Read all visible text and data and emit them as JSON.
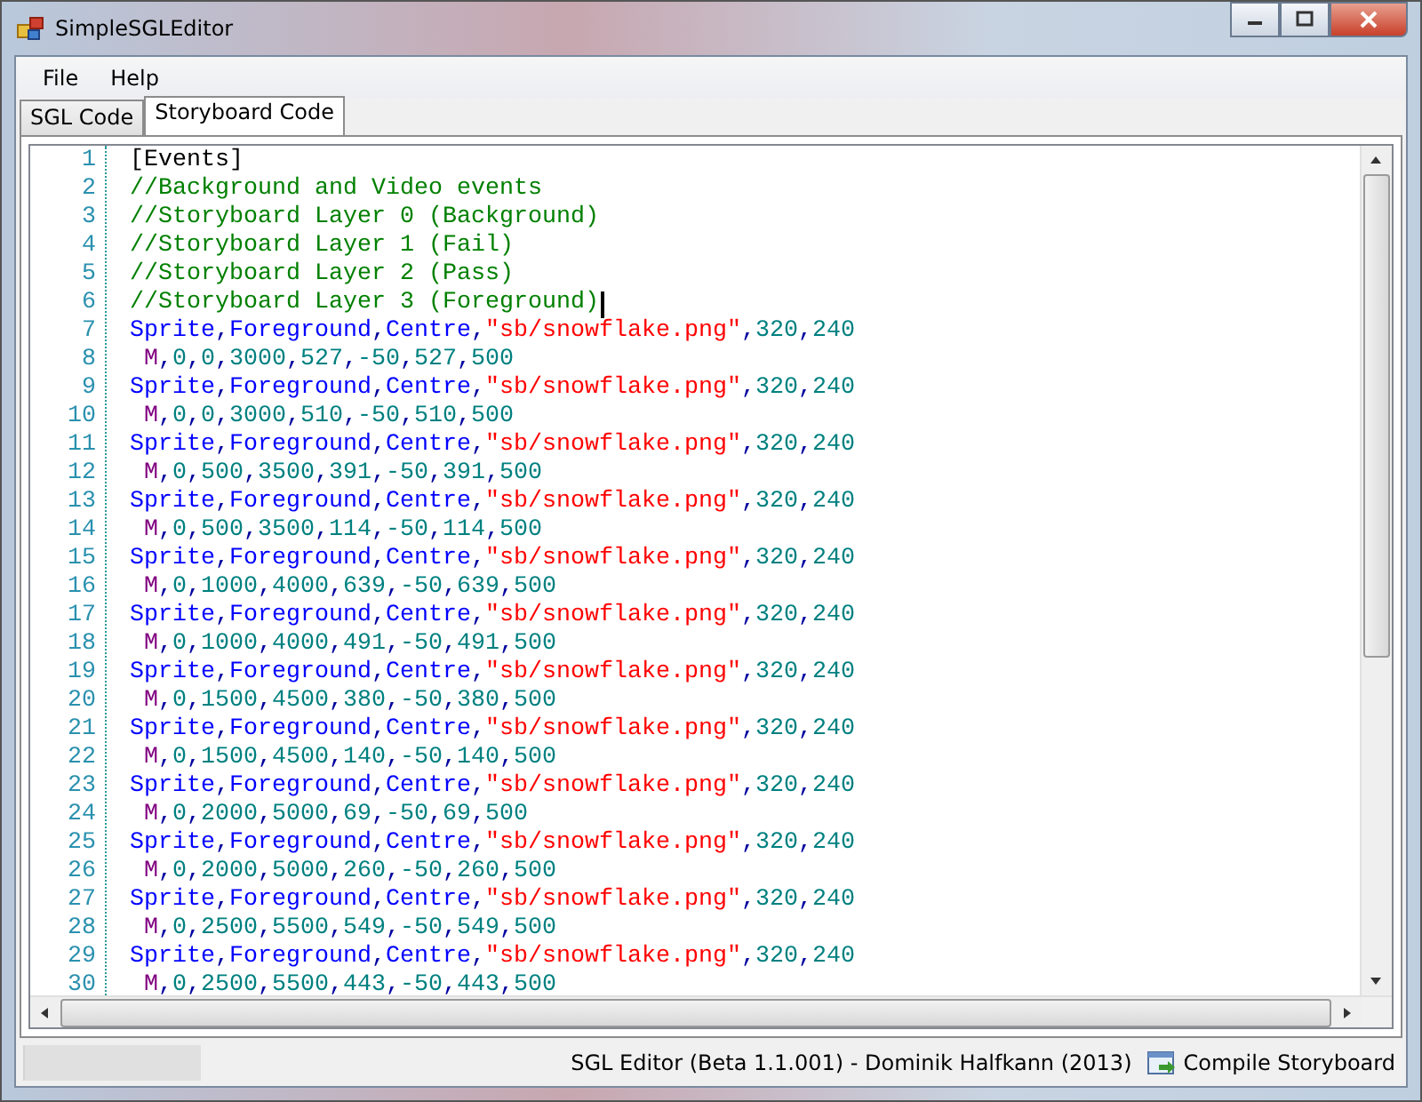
{
  "window": {
    "title": "SimpleSGLEditor"
  },
  "menu": [
    "File",
    "Help"
  ],
  "tabs": [
    {
      "label": "SGL Code",
      "selected": false
    },
    {
      "label": "Storyboard Code",
      "selected": true
    }
  ],
  "editor": {
    "lines": [
      {
        "number": "1",
        "kind": "section",
        "text": "[Events]",
        "caret": false
      },
      {
        "number": "2",
        "kind": "comment",
        "text": "//Background and Video events",
        "caret": false
      },
      {
        "number": "3",
        "kind": "comment",
        "text": "//Storyboard Layer 0 (Background)",
        "caret": false
      },
      {
        "number": "4",
        "kind": "comment",
        "text": "//Storyboard Layer 1 (Fail)",
        "caret": false
      },
      {
        "number": "5",
        "kind": "comment",
        "text": "//Storyboard Layer 2 (Pass)",
        "caret": false
      },
      {
        "number": "6",
        "kind": "comment",
        "text": "//Storyboard Layer 3 (Foreground)",
        "caret": true
      },
      {
        "number": "7",
        "kind": "sprite",
        "text": "Sprite,Foreground,Centre,\"sb/snowflake.png\",320,240",
        "caret": false
      },
      {
        "number": "8",
        "kind": "move",
        "text": " M,0,0,3000,527,-50,527,500",
        "caret": false
      },
      {
        "number": "9",
        "kind": "sprite",
        "text": "Sprite,Foreground,Centre,\"sb/snowflake.png\",320,240",
        "caret": false
      },
      {
        "number": "10",
        "kind": "move",
        "text": " M,0,0,3000,510,-50,510,500",
        "caret": false
      },
      {
        "number": "11",
        "kind": "sprite",
        "text": "Sprite,Foreground,Centre,\"sb/snowflake.png\",320,240",
        "caret": false
      },
      {
        "number": "12",
        "kind": "move",
        "text": " M,0,500,3500,391,-50,391,500",
        "caret": false
      },
      {
        "number": "13",
        "kind": "sprite",
        "text": "Sprite,Foreground,Centre,\"sb/snowflake.png\",320,240",
        "caret": false
      },
      {
        "number": "14",
        "kind": "move",
        "text": " M,0,500,3500,114,-50,114,500",
        "caret": false
      },
      {
        "number": "15",
        "kind": "sprite",
        "text": "Sprite,Foreground,Centre,\"sb/snowflake.png\",320,240",
        "caret": false
      },
      {
        "number": "16",
        "kind": "move",
        "text": " M,0,1000,4000,639,-50,639,500",
        "caret": false
      },
      {
        "number": "17",
        "kind": "sprite",
        "text": "Sprite,Foreground,Centre,\"sb/snowflake.png\",320,240",
        "caret": false
      },
      {
        "number": "18",
        "kind": "move",
        "text": " M,0,1000,4000,491,-50,491,500",
        "caret": false
      },
      {
        "number": "19",
        "kind": "sprite",
        "text": "Sprite,Foreground,Centre,\"sb/snowflake.png\",320,240",
        "caret": false
      },
      {
        "number": "20",
        "kind": "move",
        "text": " M,0,1500,4500,380,-50,380,500",
        "caret": false
      },
      {
        "number": "21",
        "kind": "sprite",
        "text": "Sprite,Foreground,Centre,\"sb/snowflake.png\",320,240",
        "caret": false
      },
      {
        "number": "22",
        "kind": "move",
        "text": " M,0,1500,4500,140,-50,140,500",
        "caret": false
      },
      {
        "number": "23",
        "kind": "sprite",
        "text": "Sprite,Foreground,Centre,\"sb/snowflake.png\",320,240",
        "caret": false
      },
      {
        "number": "24",
        "kind": "move",
        "text": " M,0,2000,5000,69,-50,69,500",
        "caret": false
      },
      {
        "number": "25",
        "kind": "sprite",
        "text": "Sprite,Foreground,Centre,\"sb/snowflake.png\",320,240",
        "caret": false
      },
      {
        "number": "26",
        "kind": "move",
        "text": " M,0,2000,5000,260,-50,260,500",
        "caret": false
      },
      {
        "number": "27",
        "kind": "sprite",
        "text": "Sprite,Foreground,Centre,\"sb/snowflake.png\",320,240",
        "caret": false
      },
      {
        "number": "28",
        "kind": "move",
        "text": " M,0,2500,5500,549,-50,549,500",
        "caret": false
      },
      {
        "number": "29",
        "kind": "sprite",
        "text": "Sprite,Foreground,Centre,\"sb/snowflake.png\",320,240",
        "caret": false
      },
      {
        "number": "30",
        "kind": "move",
        "text": " M,0,2500,5500,443,-50,443,500",
        "caret": false
      }
    ]
  },
  "status_bar": {
    "progress": {
      "level": 0
    },
    "text": "SGL Editor (Beta 1.1.001) - Dominik Halfkann (2013)",
    "button": "Compile Storyboard"
  }
}
